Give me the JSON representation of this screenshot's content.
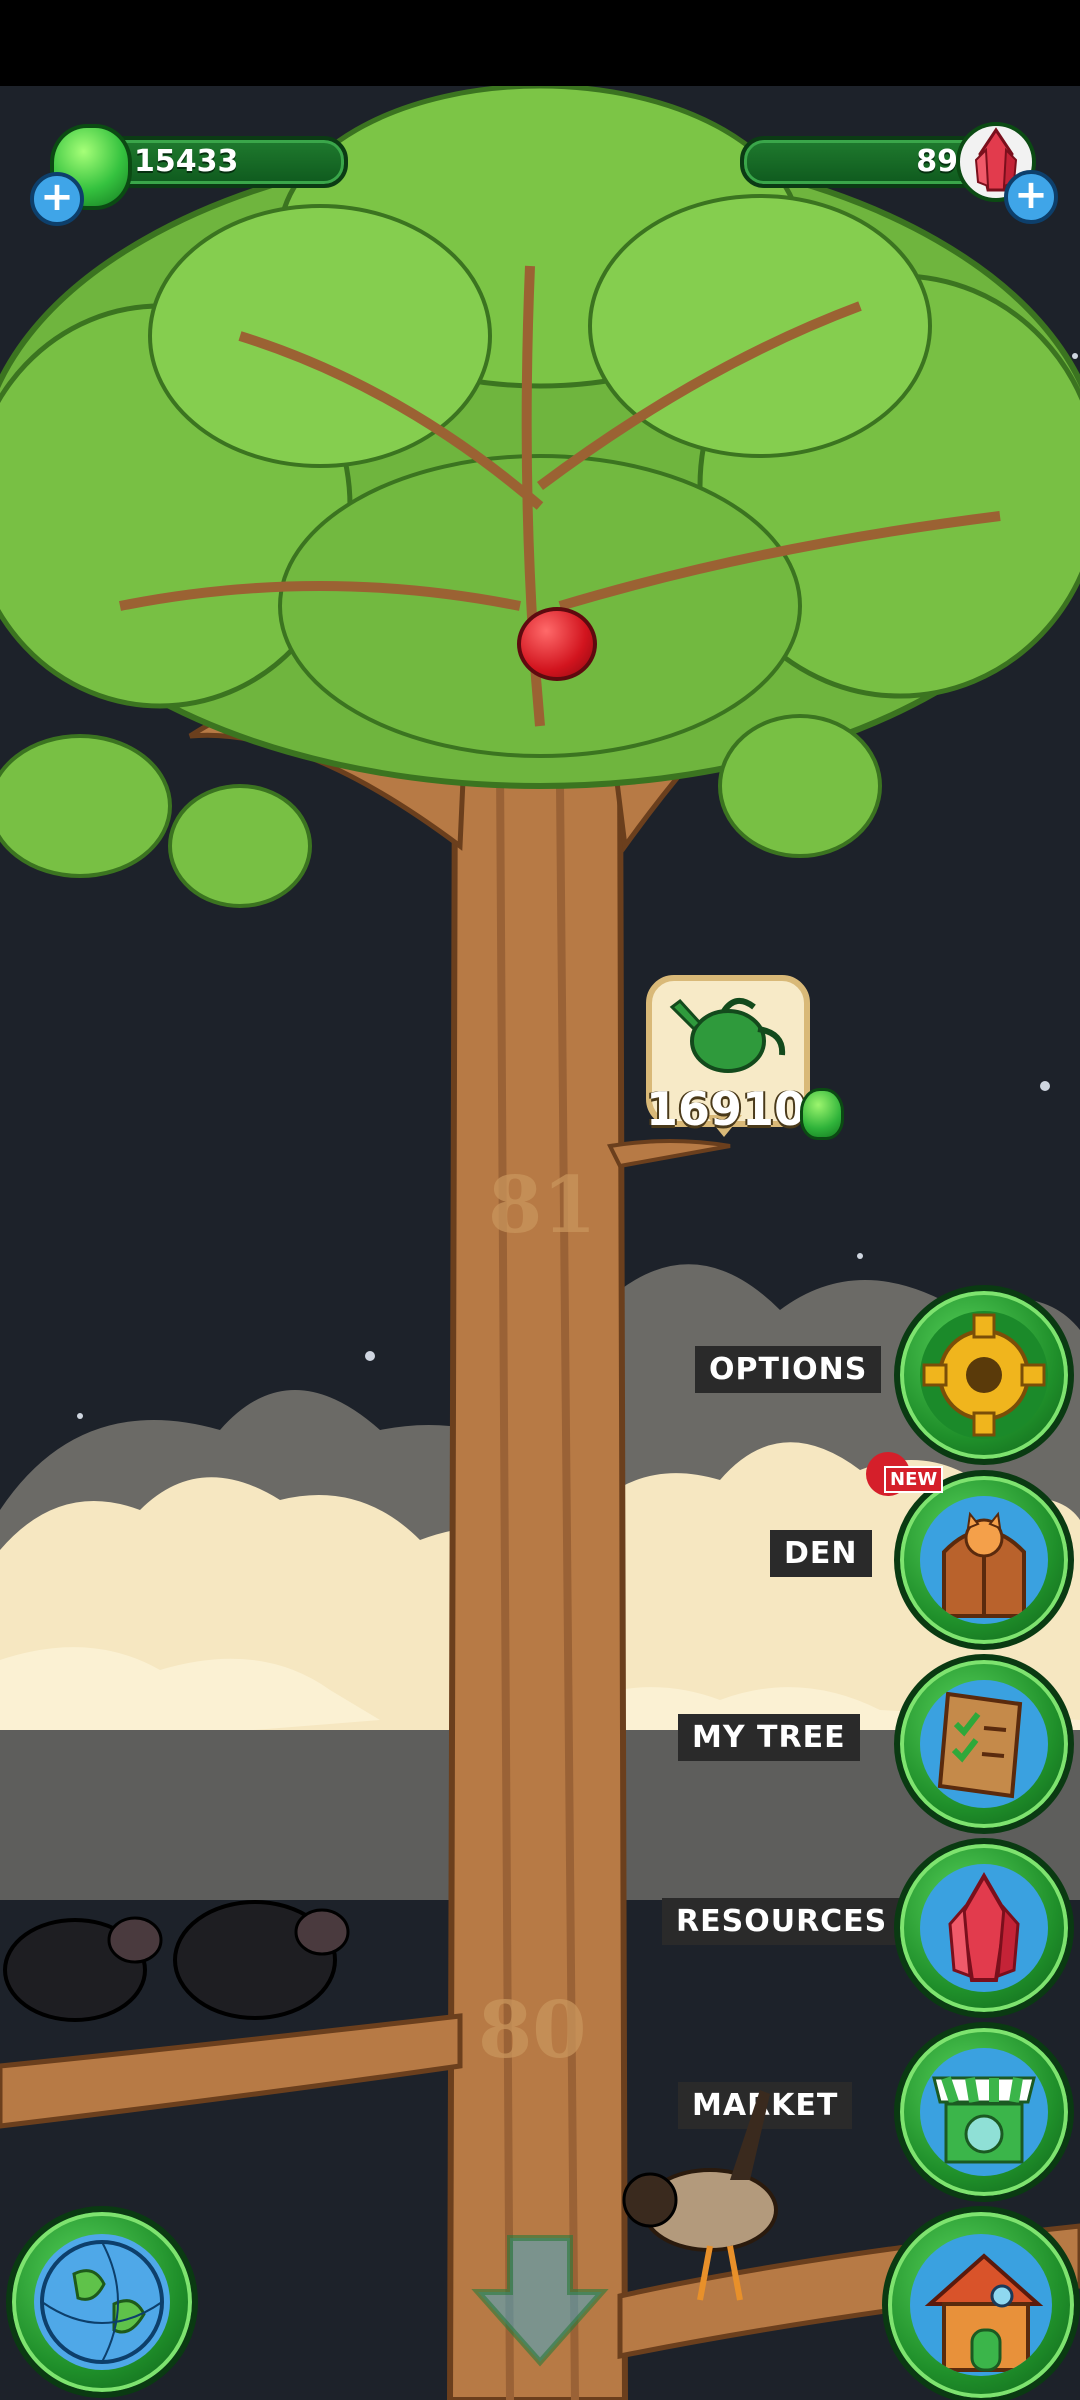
{
  "status_bar": {},
  "hud": {
    "currency_left": {
      "value": "15433",
      "icon": "green-gem-icon"
    },
    "currency_right": {
      "value": "89",
      "icon": "red-crystal-icon"
    }
  },
  "tree": {
    "level_upper": "81",
    "level_lower": "80",
    "water_cost": "16910",
    "water_icon": "watering-can-icon"
  },
  "menu": {
    "options": {
      "label": "OPTIONS",
      "icon": "gear-icon"
    },
    "den": {
      "label": "DEN",
      "icon": "den-door-icon",
      "badge": "NEW"
    },
    "my_tree": {
      "label": "MY TREE",
      "icon": "checklist-scroll-icon"
    },
    "resources": {
      "label": "RESOURCES",
      "icon": "red-crystal-icon"
    },
    "market": {
      "label": "MARKET",
      "icon": "market-stall-icon"
    }
  },
  "colors": {
    "accent_green": "#2fb33a",
    "bar_dark": "#0f5a1e",
    "label_bg": "#2a2a2a",
    "trunk": "#b77a45",
    "sky": "#1d222a"
  }
}
